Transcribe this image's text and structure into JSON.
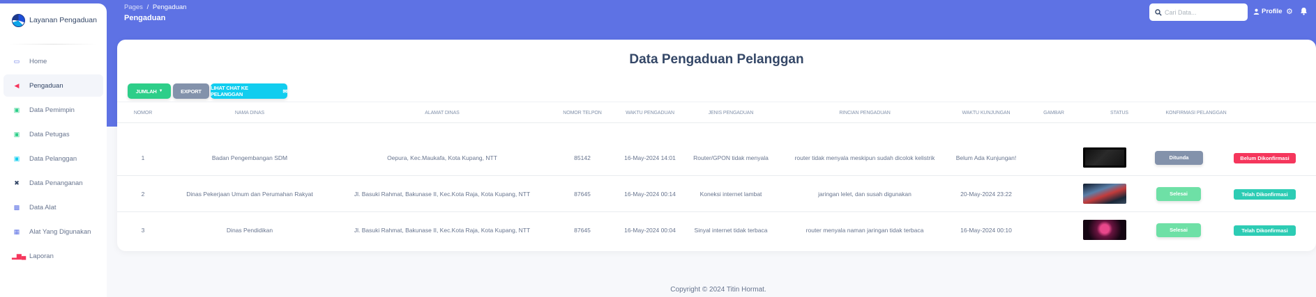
{
  "sidebar": {
    "brand": "Layanan Pengaduan",
    "items": [
      {
        "label": "Home",
        "icon": "monitor-icon",
        "color": "#5e72e4",
        "active": false
      },
      {
        "label": "Pengaduan",
        "icon": "megaphone-icon",
        "color": "#f5365c",
        "active": true
      },
      {
        "label": "Data Pemimpin",
        "icon": "briefcase-icon",
        "color": "#2dce89",
        "active": false
      },
      {
        "label": "Data Petugas",
        "icon": "briefcase-icon",
        "color": "#2dce89",
        "active": false
      },
      {
        "label": "Data Pelanggan",
        "icon": "briefcase-icon",
        "color": "#11cdef",
        "active": false
      },
      {
        "label": "Data Penanganan",
        "icon": "tools-icon",
        "color": "#344767",
        "active": false
      },
      {
        "label": "Data Alat",
        "icon": "inbox-icon",
        "color": "#5e72e4",
        "active": false
      },
      {
        "label": "Alat Yang Digunakan",
        "icon": "gift-icon",
        "color": "#5e72e4",
        "active": false
      },
      {
        "label": "Laporan",
        "icon": "bar-chart-icon",
        "color": "#f5365c",
        "active": false
      }
    ]
  },
  "header": {
    "breadcrumb_parent": "Pages",
    "breadcrumb_separator": "/",
    "breadcrumb_current": "Pengaduan",
    "page_title": "Pengaduan",
    "search_placeholder": "Cari Data...",
    "profile_label": "Profile"
  },
  "card": {
    "title": "Data Pengaduan Pelanggan",
    "buttons": {
      "jumlah": "JUMLAH",
      "export": "EXPORT",
      "chat": "LIHAT CHAT KE PELANGGAN"
    },
    "columns": [
      "NOMOR",
      "NAMA DINAS",
      "ALAMAT DINAS",
      "NOMOR TELPON",
      "WAKTU PENGADUAN",
      "JENIS PENGADUAN",
      "RINCIAN PENGADUAN",
      "WAKTU KUNJUNGAN",
      "GAMBAR",
      "STATUS",
      "KONFIRMASI PELANGGAN"
    ],
    "rows": [
      {
        "nomor": "1",
        "nama_dinas": "Badan Pengembangan SDM",
        "alamat": "Oepura, Kec.Maukafa, Kota Kupang, NTT",
        "telpon": "85142",
        "waktu_pengaduan": "16-May-2024 14:01",
        "jenis": "Router/GPON tidak menyala",
        "rincian": "router tidak menyala meskipun sudah dicolok kelistrik",
        "waktu_kunjungan": "Belum Ada Kunjungan!",
        "status": "Ditunda",
        "konfirmasi": "Belum Dikonfirmasi"
      },
      {
        "nomor": "2",
        "nama_dinas": "Dinas Pekerjaan Umum dan Perumahan Rakyat",
        "alamat": "Jl. Basuki Rahmat, Bakunase II, Kec.Kota Raja, Kota Kupang, NTT",
        "telpon": "87645",
        "waktu_pengaduan": "16-May-2024 00:14",
        "jenis": "Koneksi internet lambat",
        "rincian": "jaringan lelet, dan susah digunakan",
        "waktu_kunjungan": "20-May-2024 23:22",
        "status": "Selesai",
        "konfirmasi": "Telah Dikonfirmasi"
      },
      {
        "nomor": "3",
        "nama_dinas": "Dinas Pendidikan",
        "alamat": "Jl. Basuki Rahmat, Bakunase II, Kec.Kota Raja, Kota Kupang, NTT",
        "telpon": "87645",
        "waktu_pengaduan": "16-May-2024 00:04",
        "jenis": "Sinyal internet tidak terbaca",
        "rincian": "router menyala naman jaringan tidak terbaca",
        "waktu_kunjungan": "16-May-2024 00:10",
        "status": "Selesai",
        "konfirmasi": "Telah Dikonfirmasi"
      }
    ]
  },
  "footer": {
    "copyright": "Copyright © 2024 Titin Hormat."
  },
  "colors": {
    "primary": "#5e72e4",
    "success": "#2dce89",
    "info": "#11cdef",
    "secondary": "#8392ab",
    "danger": "#f5365c"
  }
}
